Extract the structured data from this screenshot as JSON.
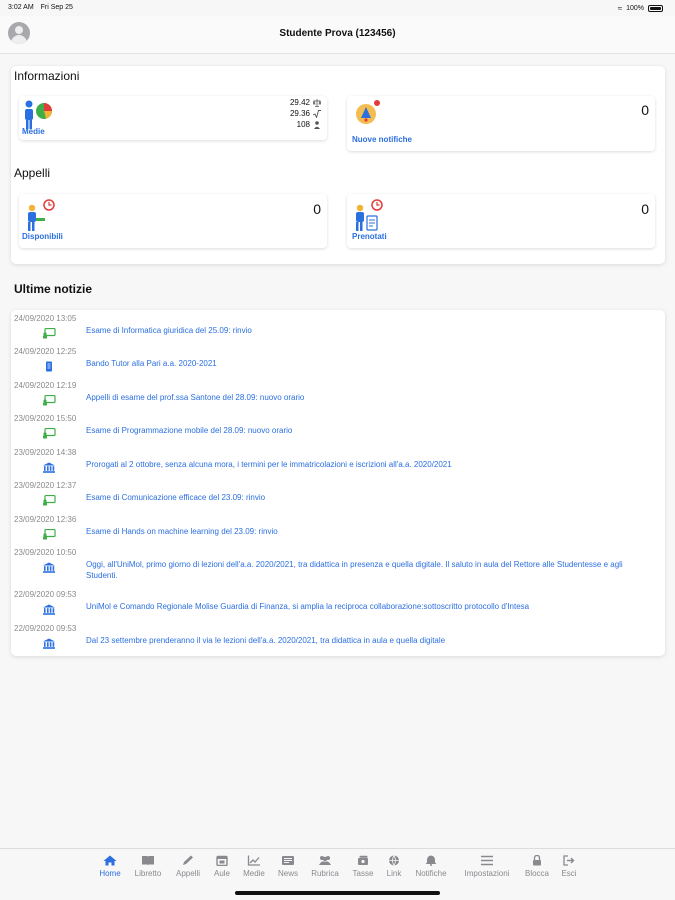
{
  "status_bar": {
    "time": "3:02 AM",
    "date": "Fri Sep 25",
    "battery": "100%"
  },
  "header": {
    "title": "Studente Prova (123456)"
  },
  "informazioni": {
    "section_title": "Informazioni",
    "medie": {
      "label": "Medie",
      "stats": [
        "29.42",
        "29.36",
        "108"
      ]
    },
    "notifiche": {
      "label": "Nuove notifiche",
      "count": "0"
    }
  },
  "appelli": {
    "section_title": "Appelli",
    "disponibili": {
      "label": "Disponibili",
      "count": "0"
    },
    "prenotati": {
      "label": "Prenotati",
      "count": "0"
    }
  },
  "news": {
    "title": "Ultime notizie",
    "items": [
      {
        "date": "24/09/2020 13:05",
        "icon": "exam-icon",
        "text": "Esame di Informatica giuridica del 25.09: rinvio"
      },
      {
        "date": "24/09/2020 12:25",
        "icon": "document-icon",
        "text": "Bando Tutor alla Pari a.a. 2020-2021"
      },
      {
        "date": "24/09/2020 12:19",
        "icon": "exam-icon",
        "text": "Appelli di esame del prof.ssa Santone del 28.09: nuovo orario"
      },
      {
        "date": "23/09/2020 15:50",
        "icon": "exam-icon",
        "text": "Esame di Programmazione mobile del 28.09: nuovo orario"
      },
      {
        "date": "23/09/2020 14:38",
        "icon": "university-icon",
        "text": "Prorogati al 2 ottobre, senza alcuna mora, i termini per le immatricolazioni e iscrizioni all'a.a. 2020/2021"
      },
      {
        "date": "23/09/2020 12:37",
        "icon": "exam-icon",
        "text": "Esame di Comunicazione efficace del 23.09: rinvio"
      },
      {
        "date": "23/09/2020 12:36",
        "icon": "exam-icon",
        "text": "Esame di Hands on machine learning del 23.09: rinvio"
      },
      {
        "date": "23/09/2020 10:50",
        "icon": "university-icon",
        "text": "Oggi, all'UniMol, primo giorno di lezioni dell'a.a. 2020/2021, tra didattica in presenza e quella digitale. Il saluto in aula del Rettore alle Studentesse e agli Studenti."
      },
      {
        "date": "22/09/2020 09:53",
        "icon": "university-icon",
        "text": "UniMol e Comando Regionale Molise Guardia di Finanza, si amplia la reciproca collaborazione:sottoscritto protocollo d'Intesa"
      },
      {
        "date": "22/09/2020 09:53",
        "icon": "university-icon",
        "text": "Dal 23 settembre prenderanno il via le lezioni dell'a.a. 2020/2021, tra didattica in aula e quella digitale"
      }
    ]
  },
  "tabs": [
    {
      "label": "Home",
      "icon": "home-icon",
      "active": true
    },
    {
      "label": "Libretto",
      "icon": "book-icon"
    },
    {
      "label": "Appelli",
      "icon": "pencil-icon"
    },
    {
      "label": "Aule",
      "icon": "calendar-icon"
    },
    {
      "label": "Medie",
      "icon": "chart-icon"
    },
    {
      "label": "News",
      "icon": "news-icon"
    },
    {
      "label": "Rubrica",
      "icon": "people-icon"
    },
    {
      "label": "Tasse",
      "icon": "money-icon"
    },
    {
      "label": "Link",
      "icon": "globe-icon"
    },
    {
      "label": "Notifiche",
      "icon": "bell-icon"
    },
    {
      "label": "Impostazioni",
      "icon": "settings-icon"
    },
    {
      "label": "Blocca",
      "icon": "lock-icon"
    },
    {
      "label": "Esci",
      "icon": "logout-icon"
    }
  ],
  "colors": {
    "accent": "#2b6fe0",
    "exam_icon": "#3fae49",
    "university_icon": "#2b6fe0",
    "alert_red": "#e23b3b"
  }
}
